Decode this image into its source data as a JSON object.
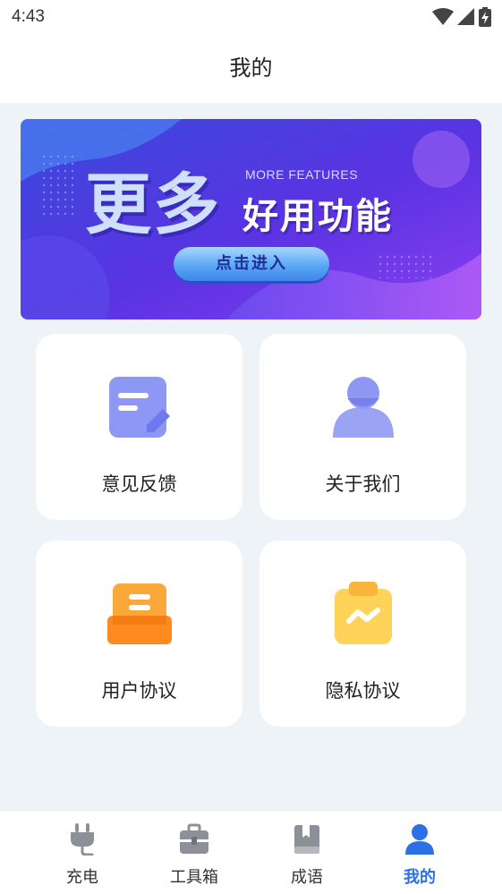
{
  "status_bar": {
    "time": "4:43",
    "icons": [
      "wifi-icon",
      "cellular-signal-icon",
      "battery-charging-icon"
    ]
  },
  "header": {
    "title": "我的"
  },
  "banner": {
    "headline": "更多",
    "english_caption": "MORE FEATURES",
    "subtitle": "好用功能",
    "button_label": "点击进入",
    "colors": {
      "gradient_start": "#3f3fd8",
      "gradient_end": "#9a3ff0",
      "button": "#5aa7f5"
    }
  },
  "menu": {
    "items": [
      {
        "label": "意见反馈",
        "icon": "feedback-icon"
      },
      {
        "label": "关于我们",
        "icon": "user-profile-icon"
      },
      {
        "label": "用户协议",
        "icon": "document-box-icon"
      },
      {
        "label": "隐私协议",
        "icon": "clipboard-icon"
      }
    ]
  },
  "tab_bar": {
    "active_index": 3,
    "accent_color": "#2f6fe6",
    "items": [
      {
        "label": "充电",
        "icon": "plug-icon"
      },
      {
        "label": "工具箱",
        "icon": "toolbox-icon"
      },
      {
        "label": "成语",
        "icon": "book-icon"
      },
      {
        "label": "我的",
        "icon": "person-icon"
      }
    ]
  }
}
